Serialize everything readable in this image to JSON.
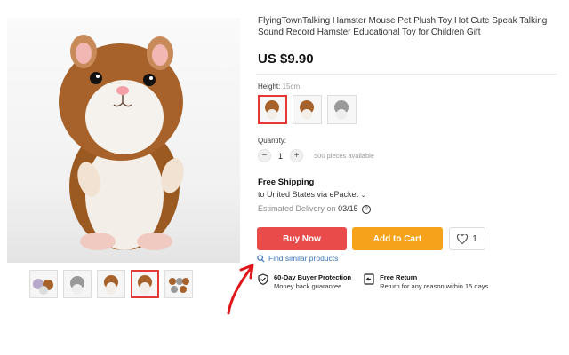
{
  "product": {
    "title": "FlyingTownTalking Hamster Mouse Pet Plush Toy Hot Cute Speak Talking Sound Record Hamster Educational Toy for Children Gift",
    "price": "US $9.90"
  },
  "variants": {
    "label": "Height:",
    "value": "15cm",
    "options": [
      {
        "name": "brown-hamster",
        "selected": true
      },
      {
        "name": "brown-hamster-alt",
        "selected": false
      },
      {
        "name": "grey-hamster",
        "selected": false
      }
    ]
  },
  "quantity": {
    "label": "Quantity:",
    "minus": "−",
    "value": "1",
    "plus": "+",
    "available": "500 pieces available"
  },
  "shipping": {
    "title": "Free Shipping",
    "destination": "to United States via ePacket",
    "estimated_label": "Estimated Delivery on",
    "estimated_date": "03/15"
  },
  "actions": {
    "buy_now": "Buy Now",
    "add_to_cart": "Add to Cart",
    "wishlist_count": "1",
    "find_similar": "Find similar products"
  },
  "guarantees": [
    {
      "title": "60-Day Buyer Protection",
      "subtitle": "Money back guarantee"
    },
    {
      "title": "Free Return",
      "subtitle": "Return for any reason within 15 days"
    }
  ],
  "thumbnails": [
    "multiple-hamsters",
    "grey-hamster",
    "brown-hamster",
    "brown-hamster",
    "hamster-group"
  ],
  "colors": {
    "buy": "#e94b4b",
    "cart": "#f7a21b",
    "link": "#3b73b9",
    "annotation": "#e0161b"
  }
}
